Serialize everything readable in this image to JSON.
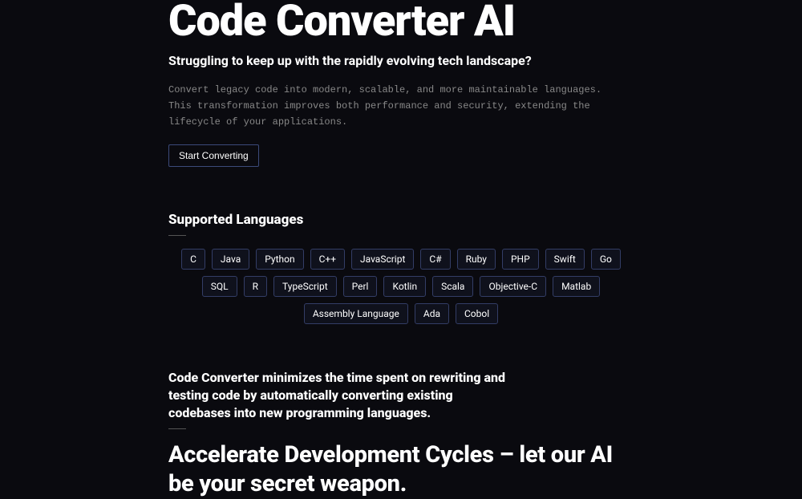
{
  "hero": {
    "title": "Code Converter AI",
    "subtitle": "Struggling to keep up with the rapidly evolving tech landscape?",
    "description": "Convert legacy code into modern, scalable, and more maintainable languages. This transformation improves both performance and security, extending the lifecycle of your applications.",
    "cta_label": "Start Converting"
  },
  "languages": {
    "heading": "Supported Languages",
    "items": [
      "C",
      "Java",
      "Python",
      "C++",
      "JavaScript",
      "C#",
      "Ruby",
      "PHP",
      "Swift",
      "Go",
      "SQL",
      "R",
      "TypeScript",
      "Perl",
      "Kotlin",
      "Scala",
      "Objective-C",
      "Matlab",
      "Assembly Language",
      "Ada",
      "Cobol"
    ]
  },
  "benefit": {
    "text": "Code Converter minimizes the time spent on rewriting and testing code by automatically converting existing codebases into new programming languages.",
    "heading": "Accelerate Development Cycles – let our AI be your secret weapon."
  }
}
